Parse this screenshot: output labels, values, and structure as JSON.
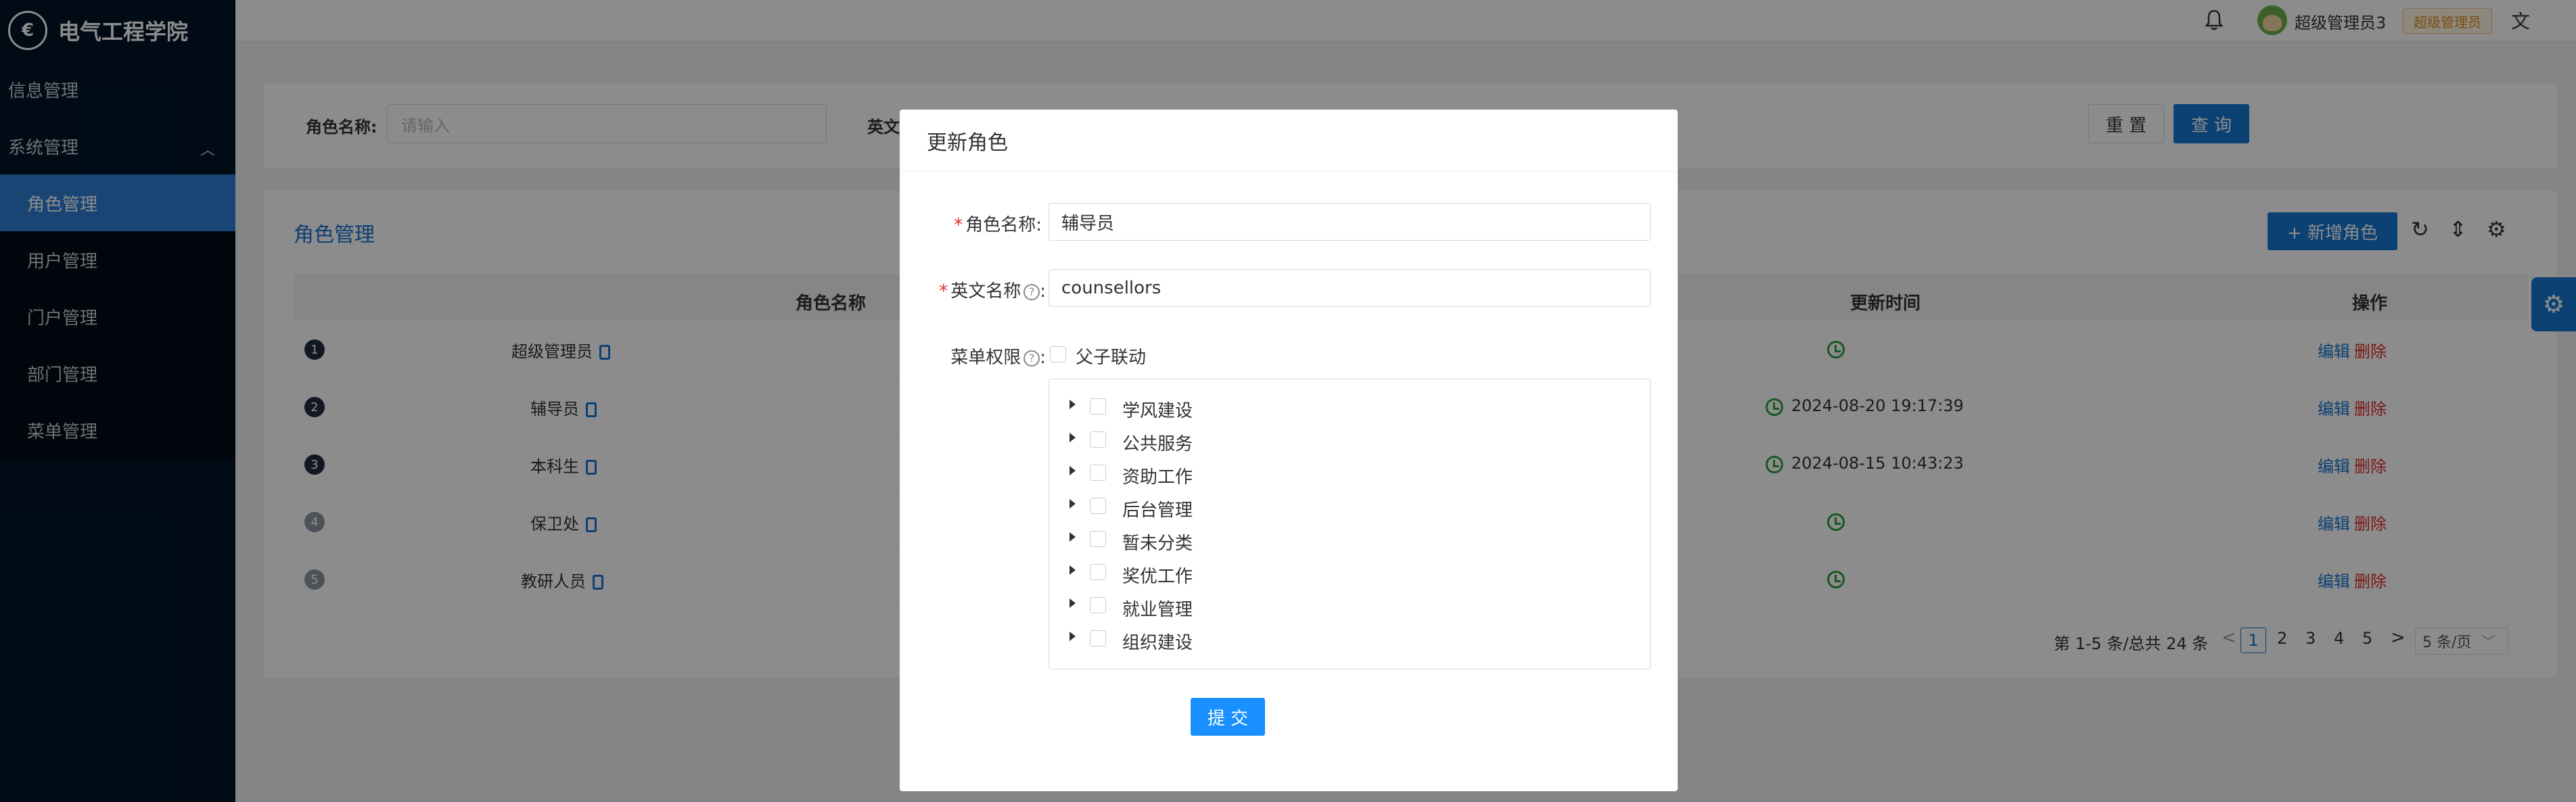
{
  "app": {
    "logo_text": "€",
    "title": "电气工程学院"
  },
  "sidebar": {
    "groups": [
      {
        "label": "信息管理"
      },
      {
        "label": "系统管理",
        "expanded": true
      }
    ],
    "sub_items": [
      {
        "label": "角色管理",
        "active": true
      },
      {
        "label": "用户管理"
      },
      {
        "label": "门户管理"
      },
      {
        "label": "部门管理"
      },
      {
        "label": "菜单管理"
      }
    ]
  },
  "header": {
    "user_name": "超级管理员3",
    "role_tag": "超级管理员",
    "icons": [
      "bell-icon",
      "avatar",
      "translate-icon"
    ]
  },
  "search": {
    "role_name_label": "角色名称:",
    "role_name_placeholder": "请输入",
    "english_name_label": "英文",
    "reset_label": "重 置",
    "query_label": "查 询"
  },
  "table": {
    "title": "角色管理",
    "add_label": "+ 新增角色",
    "headers": {
      "name": "角色名称",
      "updated": "更新时间",
      "actions": "操作"
    },
    "rows": [
      {
        "index": "1",
        "name": "超级管理员",
        "updated": "",
        "edit": "编辑",
        "delete": "删除"
      },
      {
        "index": "2",
        "name": "辅导员",
        "updated": "2024-08-20 19:17:39",
        "edit": "编辑",
        "delete": "删除"
      },
      {
        "index": "3",
        "name": "本科生",
        "updated": "2024-08-15 10:43:23",
        "edit": "编辑",
        "delete": "删除"
      },
      {
        "index": "4",
        "name": "保卫处",
        "updated": "",
        "edit": "编辑",
        "delete": "删除"
      },
      {
        "index": "5",
        "name": "教研人员",
        "updated": "",
        "edit": "编辑",
        "delete": "删除"
      }
    ],
    "pagination": {
      "summary": "第 1-5 条/总共 24 条",
      "prev": "<",
      "pages": [
        "1",
        "2",
        "3",
        "4",
        "5"
      ],
      "current": "1",
      "next": ">",
      "page_size": "5 条/页"
    }
  },
  "modal": {
    "title": "更新角色",
    "role_name_label": "角色名称:",
    "role_name_value": "辅导员",
    "english_name_label": "英文名称",
    "english_name_value": "counsellors",
    "menu_perm_label": "菜单权限",
    "linkage_label": "父子联动",
    "help_glyph": "?",
    "colon": ":",
    "tree_items": [
      "学风建设",
      "公共服务",
      "资助工作",
      "后台管理",
      "暂未分类",
      "奖优工作",
      "就业管理",
      "组织建设"
    ],
    "submit_label": "提 交"
  },
  "colors": {
    "sidebar_bg": "#001529",
    "primary": "#1677d2",
    "danger": "#e22a2a",
    "success": "#2e9e3c"
  }
}
